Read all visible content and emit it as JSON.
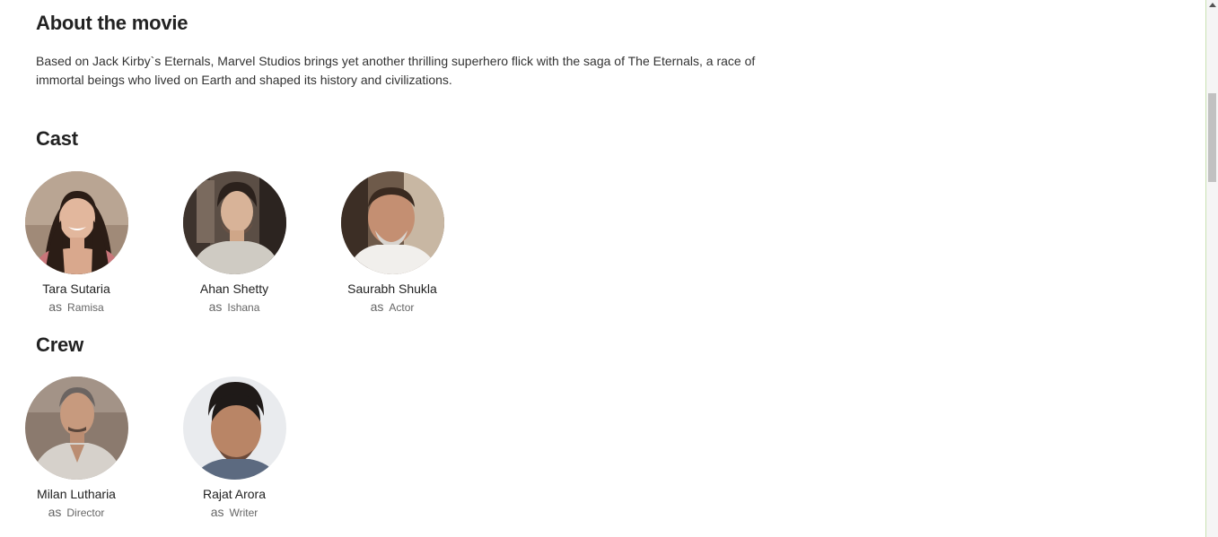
{
  "about": {
    "title": "About the movie",
    "description": "Based on Jack Kirby`s Eternals, Marvel Studios brings yet another thrilling superhero flick with the saga of The Eternals, a race of immortal beings who lived on Earth and shaped its history and civilizations."
  },
  "cast": {
    "title": "Cast",
    "as_label": "as",
    "members": [
      {
        "name": "Tara Sutaria",
        "role": "Ramisa"
      },
      {
        "name": "Ahan Shetty",
        "role": "Ishana"
      },
      {
        "name": "Saurabh Shukla",
        "role": "Actor"
      }
    ]
  },
  "crew": {
    "title": "Crew",
    "as_label": "as",
    "members": [
      {
        "name": "Milan Lutharia",
        "role": "Director"
      },
      {
        "name": "Rajat Arora",
        "role": "Writer"
      }
    ]
  },
  "colors": {
    "heading": "#222222",
    "text": "#333333",
    "role_text": "#666666",
    "scrollbar_thumb": "#c1c1c1"
  }
}
